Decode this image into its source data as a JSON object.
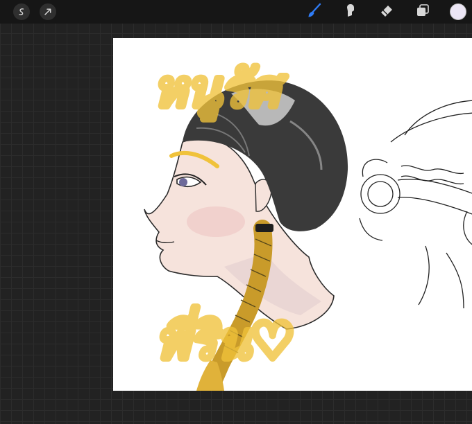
{
  "toolbar": {
    "left_buttons": [
      {
        "name": "adjustments-icon"
      },
      {
        "name": "selection-arrow-icon"
      }
    ],
    "right_tools": [
      {
        "name": "brush-icon",
        "active": true
      },
      {
        "name": "smudge-icon",
        "active": false
      },
      {
        "name": "eraser-icon",
        "active": false
      },
      {
        "name": "layers-icon",
        "active": false
      }
    ],
    "current_color": "#ece6f5"
  },
  "colors": {
    "toolbar_bg": "#161616",
    "active_tool": "#2f7cf6",
    "inactive_tool": "#d8d8d8",
    "handwriting": "#f0c23a",
    "hair": "#3a3a3a",
    "skin": "#f6e3dc"
  },
  "canvas": {
    "handwriting_top": "หนูรัศ",
    "handwriting_bottom": "พี่ริน♡"
  }
}
